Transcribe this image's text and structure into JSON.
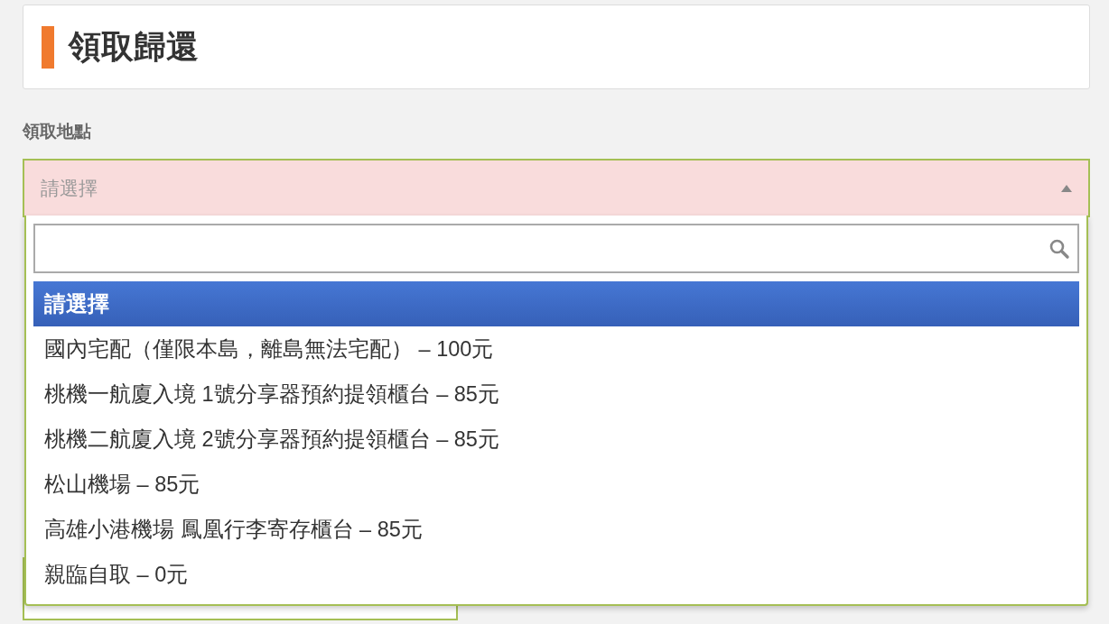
{
  "header": {
    "title": "領取歸還"
  },
  "field": {
    "label": "領取地點",
    "placeholder": "請選擇",
    "expanded": true
  },
  "dropdown": {
    "options": [
      {
        "label": "請選擇",
        "selected": true
      },
      {
        "label": "國內宅配（僅限本島，離島無法宅配） – 100元",
        "selected": false
      },
      {
        "label": "桃機一航廈入境 1號分享器預約提領櫃台 – 85元",
        "selected": false
      },
      {
        "label": "桃機二航廈入境 2號分享器預約提領櫃台 – 85元",
        "selected": false
      },
      {
        "label": "松山機場 – 85元",
        "selected": false
      },
      {
        "label": "高雄小港機場 鳳凰行李寄存櫃台 – 85元",
        "selected": false
      },
      {
        "label": "親臨自取 – 0元",
        "selected": false
      }
    ]
  }
}
